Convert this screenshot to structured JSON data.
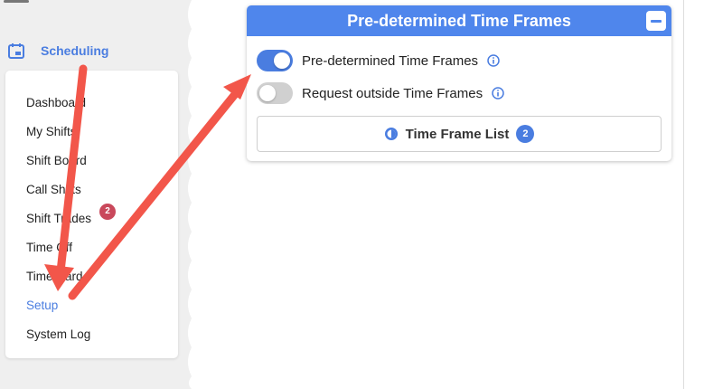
{
  "sidebar": {
    "section_title": "Scheduling",
    "section_icon": "calendar-icon",
    "items": [
      {
        "label": "Dashboard",
        "active": false
      },
      {
        "label": "My Shifts",
        "active": false
      },
      {
        "label": "Shift Board",
        "active": false
      },
      {
        "label": "Call Shifts",
        "active": false
      },
      {
        "label": "Shift Trades",
        "active": false,
        "badge": "2"
      },
      {
        "label": "Time Off",
        "active": false
      },
      {
        "label": "Time Card",
        "active": false
      },
      {
        "label": "Setup",
        "active": true
      },
      {
        "label": "System Log",
        "active": false
      }
    ]
  },
  "panel": {
    "title": "Pre-determined Time Frames",
    "collapse_icon": "minus-icon",
    "toggles": [
      {
        "label": "Pre-determined Time Frames",
        "on": true,
        "icon": "info-icon"
      },
      {
        "label": "Request outside Time Frames",
        "on": false,
        "icon": "info-icon"
      }
    ],
    "list_button": {
      "label": "Time Frame List",
      "count": "2",
      "icon": "clock-icon"
    }
  },
  "colors": {
    "accent": "#4a7de0",
    "header": "#4f86ec",
    "badge": "#c9485b",
    "arrow": "#f2564a"
  }
}
